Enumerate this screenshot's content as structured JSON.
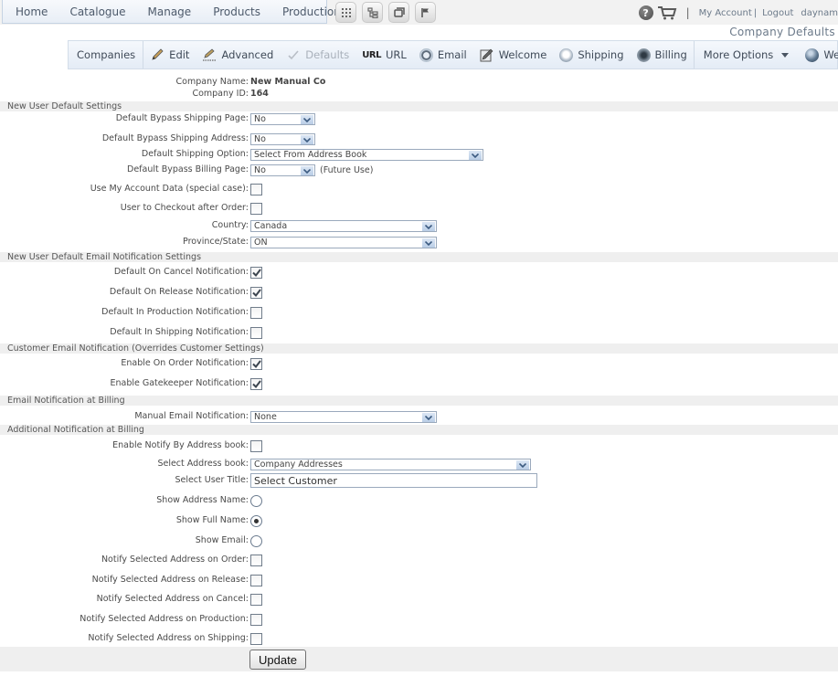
{
  "topnav": {
    "links": [
      "Home",
      "Catalogue",
      "Manage",
      "Products",
      "Production"
    ],
    "icon_buttons": [
      "grid-icon",
      "tree-icon",
      "windows-icon",
      "flag-icon"
    ],
    "my_account": "My Account",
    "logout": "Logout",
    "username": "daynam",
    "separator": "|"
  },
  "page_title": "Company Defaults",
  "toolbar": {
    "items": [
      {
        "label": "Companies",
        "icon": "none",
        "disabled": false
      },
      {
        "label": "Edit",
        "icon": "pencil-icon",
        "disabled": false
      },
      {
        "label": "Advanced",
        "icon": "advanced-pencil-icon",
        "disabled": false
      },
      {
        "label": "Defaults",
        "icon": "check-icon",
        "disabled": true
      },
      {
        "label": "URL",
        "icon": "url-icon",
        "icon_text": "URL",
        "disabled": false
      },
      {
        "label": "Email",
        "icon": "email-at-icon",
        "disabled": false
      },
      {
        "label": "Welcome",
        "icon": "welcome-note-icon",
        "disabled": false
      },
      {
        "label": "Shipping",
        "icon": "shipping-icon",
        "disabled": false
      },
      {
        "label": "Billing",
        "icon": "billing-icon",
        "disabled": false
      },
      {
        "label": "More Options",
        "icon": "chevron-down-icon",
        "disabled": false
      },
      {
        "label": "Web Site",
        "icon": "globe-icon",
        "disabled": false
      }
    ]
  },
  "company": {
    "name_label": "Company Name:",
    "name_value": "New Manual Co",
    "id_label": "Company ID:",
    "id_value": "164"
  },
  "sections": {
    "new_user": "New User Default Settings",
    "new_user_email": "New User Default Email Notification Settings",
    "customer_email": "Customer Email Notification (Overrides Customer Settings)",
    "email_billing": "Email Notification at Billing",
    "additional_billing": "Additional Notification at Billing"
  },
  "fields": {
    "bypass_shipping_page": {
      "label": "Default Bypass Shipping Page:",
      "value": "No"
    },
    "bypass_shipping_address": {
      "label": "Default Bypass Shipping Address:",
      "value": "No"
    },
    "shipping_option": {
      "label": "Default Shipping Option:",
      "value": "Select From Address Book"
    },
    "bypass_billing_page": {
      "label": "Default Bypass Billing Page:",
      "value": "No",
      "note": "(Future Use)"
    },
    "use_my_account": {
      "label": "Use My Account Data (special case):",
      "checked": false
    },
    "checkout_after_order": {
      "label": "User to Checkout after Order:",
      "checked": false
    },
    "country": {
      "label": "Country:",
      "value": "Canada"
    },
    "province": {
      "label": "Province/State:",
      "value": "ON"
    },
    "on_cancel": {
      "label": "Default On Cancel Notification:",
      "checked": true
    },
    "on_release": {
      "label": "Default On Release Notification:",
      "checked": true
    },
    "in_production": {
      "label": "Default In Production Notification:",
      "checked": false
    },
    "in_shipping": {
      "label": "Default In Shipping Notification:",
      "checked": false
    },
    "on_order": {
      "label": "Enable On Order Notification:",
      "checked": true
    },
    "gatekeeper": {
      "label": "Enable Gatekeeper Notification:",
      "checked": true
    },
    "manual_email": {
      "label": "Manual Email Notification:",
      "value": "None"
    },
    "notify_by_address_book": {
      "label": "Enable Notify By Address book:",
      "checked": false
    },
    "address_book": {
      "label": "Select Address book:",
      "value": "Company Addresses"
    },
    "user_title": {
      "label": "Select User Title:",
      "value": "Select Customer"
    },
    "show_address_name": {
      "label": "Show Address Name:",
      "selected": false
    },
    "show_full_name": {
      "label": "Show Full Name:",
      "selected": true
    },
    "show_email": {
      "label": "Show Email:",
      "selected": false
    },
    "notify_on_order": {
      "label": "Notify Selected Address on Order:",
      "checked": false
    },
    "notify_on_release": {
      "label": "Notify Selected Address on Release:",
      "checked": false
    },
    "notify_on_cancel": {
      "label": "Notify Selected Address on Cancel:",
      "checked": false
    },
    "notify_on_production": {
      "label": "Notify Selected Address on Production:",
      "checked": false
    },
    "notify_on_shipping": {
      "label": "Notify Selected Address on Shipping:",
      "checked": false
    }
  },
  "update_label": "Update"
}
